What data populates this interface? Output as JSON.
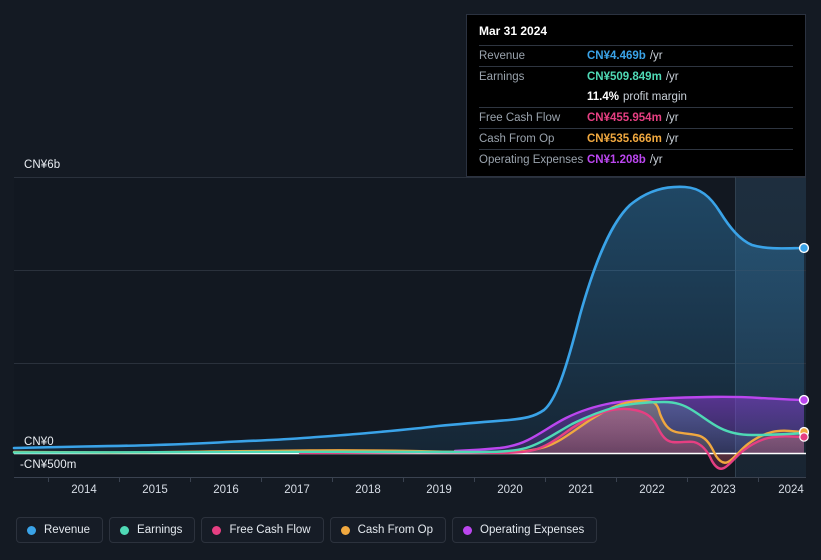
{
  "theme": {
    "background": "#141a23",
    "grid": "#2a313c",
    "zero_line": "#ffffff",
    "text": "#e9edf2",
    "muted_text": "#9aa3ad"
  },
  "tooltip": {
    "date": "Mar 31 2024",
    "rows": [
      {
        "name": "Revenue",
        "value": "CN¥4.469b",
        "unit": "/yr",
        "color": "#3aa3e8"
      },
      {
        "name": "Earnings",
        "value": "CN¥509.849m",
        "unit": "/yr",
        "color": "#4fd9b5"
      },
      {
        "name": "",
        "value": "11.4%",
        "unit": "profit margin",
        "color": "#ffffff"
      },
      {
        "name": "Free Cash Flow",
        "value": "CN¥455.954m",
        "unit": "/yr",
        "color": "#e63f82"
      },
      {
        "name": "Cash From Op",
        "value": "CN¥535.666m",
        "unit": "/yr",
        "color": "#f0a83f"
      },
      {
        "name": "Operating Expenses",
        "value": "CN¥1.208b",
        "unit": "/yr",
        "color": "#bb46ef"
      }
    ]
  },
  "legend": {
    "items": [
      {
        "label": "Revenue",
        "color": "#3aa3e8"
      },
      {
        "label": "Earnings",
        "color": "#4fd9b5"
      },
      {
        "label": "Free Cash Flow",
        "color": "#e63f82"
      },
      {
        "label": "Cash From Op",
        "color": "#f0a83f"
      },
      {
        "label": "Operating Expenses",
        "color": "#bb46ef"
      }
    ]
  },
  "chart_data": {
    "type": "area",
    "title": "",
    "xlabel": "",
    "ylabel": "",
    "grid": true,
    "legend_position": "bottom",
    "x": [
      2013.5,
      2014,
      2015,
      2016,
      2017,
      2018,
      2019,
      2020,
      2020.5,
      2021,
      2021.5,
      2022,
      2022.5,
      2023,
      2023.5,
      2024,
      2024.3
    ],
    "x_ticks": [
      "2014",
      "2015",
      "2016",
      "2017",
      "2018",
      "2019",
      "2020",
      "2021",
      "2022",
      "2023",
      "2024"
    ],
    "y_ticks": [
      "CN¥6b",
      "CN¥0",
      "-CN¥500m"
    ],
    "ylim": [
      -0.5,
      6.5
    ],
    "y_unit": "CN¥ billions",
    "forecast_start": "2023.2",
    "series": [
      {
        "name": "Revenue",
        "color": "#3aa3e8",
        "values": [
          0.1,
          0.11,
          0.13,
          0.16,
          0.2,
          0.26,
          0.33,
          0.42,
          1.3,
          3.4,
          4.95,
          5.8,
          6.0,
          5.55,
          4.85,
          4.469,
          4.469
        ]
      },
      {
        "name": "Earnings",
        "color": "#4fd9b5",
        "values": [
          0.01,
          0.01,
          0.01,
          0.02,
          0.02,
          0.03,
          0.03,
          0.04,
          0.18,
          0.52,
          0.92,
          1.1,
          1.05,
          0.82,
          0.58,
          0.509849,
          0.509849
        ]
      },
      {
        "name": "Free Cash Flow",
        "color": "#e63f82",
        "values": [
          0.0,
          0.0,
          0.0,
          0.0,
          0.01,
          0.01,
          0.02,
          0.02,
          0.22,
          0.62,
          0.9,
          0.62,
          0.58,
          -0.22,
          0.2,
          0.455954,
          0.455954
        ]
      },
      {
        "name": "Cash From Op",
        "color": "#f0a83f",
        "values": [
          0.01,
          0.01,
          0.02,
          0.02,
          0.03,
          0.04,
          0.04,
          0.05,
          0.28,
          0.78,
          1.0,
          0.72,
          0.66,
          -0.1,
          0.3,
          0.535666,
          0.535666
        ]
      },
      {
        "name": "Operating Expenses",
        "color": "#bb46ef",
        "values": [
          0.02,
          0.02,
          0.02,
          0.03,
          0.03,
          0.04,
          0.05,
          0.18,
          0.44,
          0.8,
          0.95,
          1.02,
          1.08,
          1.13,
          1.17,
          1.208,
          1.208
        ]
      }
    ]
  }
}
